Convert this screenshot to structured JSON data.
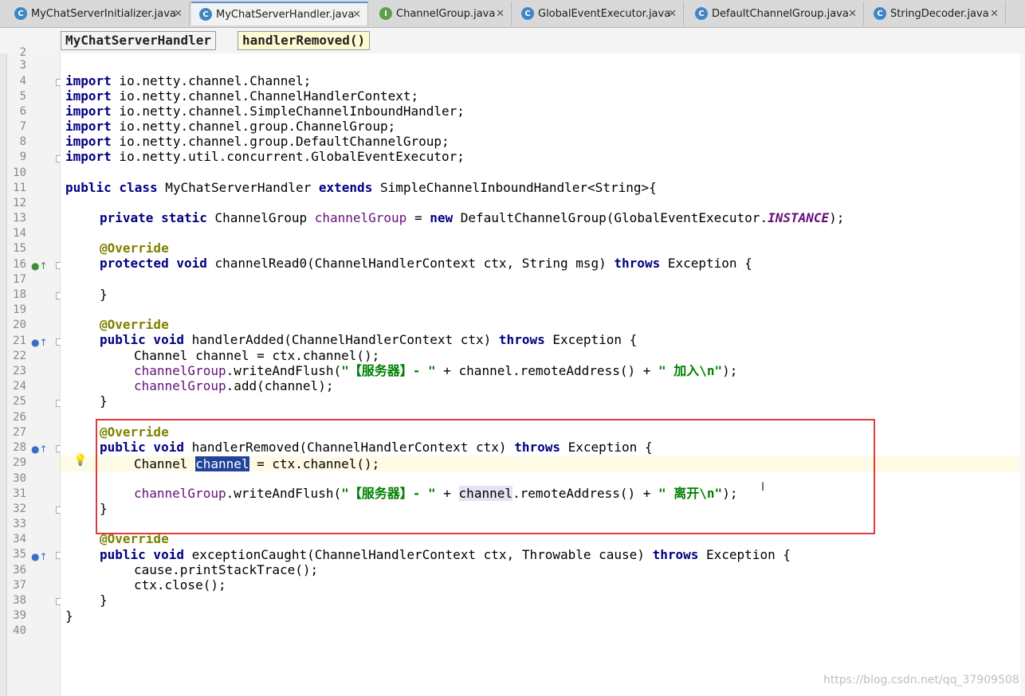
{
  "tabs": [
    {
      "label": "MyChatServerInitializer.java",
      "icon": "class-icon",
      "icon_glyph": "C",
      "active": false
    },
    {
      "label": "MyChatServerHandler.java",
      "icon": "class-icon",
      "icon_glyph": "C",
      "active": true
    },
    {
      "label": "ChannelGroup.java",
      "icon": "interface-icon",
      "icon_glyph": "I",
      "active": false
    },
    {
      "label": "GlobalEventExecutor.java",
      "icon": "class-icon",
      "icon_glyph": "C",
      "active": false
    },
    {
      "label": "DefaultChannelGroup.java",
      "icon": "class-icon",
      "icon_glyph": "C",
      "active": false
    },
    {
      "label": "StringDecoder.java",
      "icon": "class-icon",
      "icon_glyph": "C",
      "active": false
    }
  ],
  "tab_close_glyph": "✕",
  "breadcrumb": {
    "class_name": "MyChatServerHandler",
    "method_name": "handlerRemoved()"
  },
  "line_numbers": [
    "2",
    "3",
    "4",
    "5",
    "6",
    "7",
    "8",
    "9",
    "10",
    "11",
    "12",
    "13",
    "14",
    "15",
    "16",
    "17",
    "18",
    "19",
    "20",
    "21",
    "22",
    "23",
    "24",
    "25",
    "26",
    "27",
    "28",
    "29",
    "30",
    "31",
    "32",
    "33",
    "34",
    "35",
    "36",
    "37",
    "38",
    "39",
    "40"
  ],
  "code": {
    "l4": [
      "import",
      " io.netty.channel.Channel;"
    ],
    "l5": [
      "import",
      " io.netty.channel.ChannelHandlerContext;"
    ],
    "l6": [
      "import",
      " io.netty.channel.SimpleChannelInboundHandler;"
    ],
    "l7": [
      "import",
      " io.netty.channel.group.ChannelGroup;"
    ],
    "l8": [
      "import",
      " io.netty.channel.group.DefaultChannelGroup;"
    ],
    "l9": [
      "import",
      " io.netty.util.concurrent.GlobalEventExecutor;"
    ],
    "l11": [
      "public class",
      " MyChatServerHandler ",
      "extends",
      " SimpleChannelInboundHandler<String>{"
    ],
    "l13": [
      "private static",
      " ChannelGroup ",
      "channelGroup",
      " = ",
      "new",
      " DefaultChannelGroup(GlobalEventExecutor.",
      "INSTANCE",
      ");"
    ],
    "l15": [
      "@Override"
    ],
    "l16": [
      "protected void",
      " channelRead0(ChannelHandlerContext ctx, String msg) ",
      "throws",
      " Exception {"
    ],
    "l18": [
      "}"
    ],
    "l20": [
      "@Override"
    ],
    "l21": [
      "public void",
      " handlerAdded(ChannelHandlerContext ctx) ",
      "throws",
      " Exception {"
    ],
    "l22": [
      "Channel channel = ctx.channel();"
    ],
    "l23": [
      "channelGroup",
      ".writeAndFlush(",
      "\"【服务器】- \"",
      " + channel.remoteAddress() + ",
      "\" 加入\\n\"",
      ");"
    ],
    "l24": [
      "channelGroup",
      ".add(channel);"
    ],
    "l25": [
      "}"
    ],
    "l27": [
      "@Override"
    ],
    "l28": [
      "public void",
      " handlerRemoved(ChannelHandlerContext ctx) ",
      "throws",
      " Exception {"
    ],
    "l29": [
      "Channel ",
      "channel",
      " = ctx.channel();"
    ],
    "l31": [
      "channelGroup",
      ".writeAndFlush(",
      "\"【服务器】- \"",
      " + ",
      "channel",
      ".remoteAddress() + ",
      "\" 离开\\n\"",
      ");"
    ],
    "l32": [
      "}"
    ],
    "l34": [
      "@Override"
    ],
    "l35": [
      "public void",
      " exceptionCaught(ChannelHandlerContext ctx, Throwable cause) ",
      "throws",
      " Exception {"
    ],
    "l36": [
      "cause.printStackTrace();"
    ],
    "l37": [
      "ctx.close();"
    ],
    "l38": [
      "}"
    ],
    "l39": [
      "}"
    ]
  },
  "watermark": "https://blog.csdn.net/qq_37909508",
  "colors": {
    "keyword": "#000080",
    "annotation": "#808000",
    "field": "#660e7a",
    "string": "#008000",
    "highlight_box": "#e03a3a",
    "selection": "#21439c"
  }
}
